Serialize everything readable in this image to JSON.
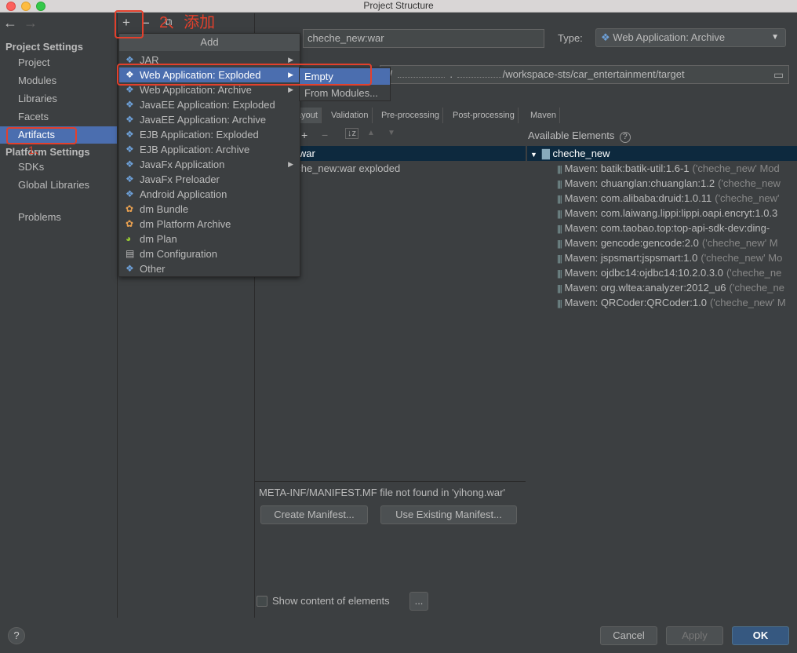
{
  "window": {
    "title": "Project Structure"
  },
  "nav": {
    "back_icon": "←",
    "forward_icon": "→",
    "project_settings_header": "Project Settings",
    "project_items": [
      "Project",
      "Modules",
      "Libraries",
      "Facets",
      "Artifacts"
    ],
    "platform_settings_header": "Platform Settings",
    "platform_items": [
      "SDKs",
      "Global Libraries"
    ],
    "problems": "Problems"
  },
  "toolbar": {
    "add": "+",
    "remove": "−"
  },
  "annotations": {
    "step2": "2、添加",
    "step1": "1、"
  },
  "artifact": {
    "name_value": "cheche_new:war",
    "type_label": "Type:",
    "type_value": "Web Application: Archive",
    "output_dir_prefix": "s/",
    "output_dir_middle": ".",
    "output_dir_value": "/workspace-sts/car_entertainment/target"
  },
  "tabs": [
    "ayout",
    "Validation",
    "Pre-processing",
    "Post-processing",
    "Maven"
  ],
  "output_tree": {
    "root": "g.war",
    "child": "eche_new:war exploded"
  },
  "available": {
    "label": "Available Elements",
    "help_icon": "?",
    "root": "cheche_new",
    "items": [
      {
        "text": "Maven: batik:batik-util:1.6-1",
        "suffix": "('cheche_new' Mod"
      },
      {
        "text": "Maven: chuanglan:chuanglan:1.2",
        "suffix": "('cheche_new"
      },
      {
        "text": "Maven: com.alibaba:druid:1.0.11",
        "suffix": "('cheche_new'"
      },
      {
        "text": "Maven: com.laiwang.lippi:lippi.oapi.encryt:1.0.3",
        "suffix": ""
      },
      {
        "text": "Maven: com.taobao.top:top-api-sdk-dev:ding-",
        "suffix": ""
      },
      {
        "text": "Maven: gencode:gencode:2.0",
        "suffix": "('cheche_new' M"
      },
      {
        "text": "Maven: jspsmart:jspsmart:1.0",
        "suffix": "('cheche_new' Mo"
      },
      {
        "text": "Maven: ojdbc14:ojdbc14:10.2.0.3.0",
        "suffix": "('cheche_ne"
      },
      {
        "text": "Maven: org.wltea:analyzer:2012_u6",
        "suffix": "('cheche_ne"
      },
      {
        "text": "Maven: QRCoder:QRCoder:1.0",
        "suffix": "('cheche_new' M"
      }
    ]
  },
  "manifest": {
    "message": "META-INF/MANIFEST.MF file not found in 'yihong.war'",
    "create_button": "Create Manifest...",
    "use_existing_button": "Use Existing Manifest..."
  },
  "show_content": {
    "label": "Show content of elements",
    "more": "..."
  },
  "footer": {
    "help": "?",
    "cancel": "Cancel",
    "apply": "Apply",
    "ok": "OK"
  },
  "add_popup": {
    "title": "Add",
    "items": [
      {
        "label": "JAR",
        "submenu": true
      },
      {
        "label": "Web Application: Exploded",
        "submenu": true
      },
      {
        "label": "Web Application: Archive",
        "submenu": true
      },
      {
        "label": "JavaEE Application: Exploded",
        "submenu": false
      },
      {
        "label": "JavaEE Application: Archive",
        "submenu": false
      },
      {
        "label": "EJB Application: Exploded",
        "submenu": false
      },
      {
        "label": "EJB Application: Archive",
        "submenu": false
      },
      {
        "label": "JavaFx Application",
        "submenu": true
      },
      {
        "label": "JavaFx Preloader",
        "submenu": false
      },
      {
        "label": "Android Application",
        "submenu": false
      },
      {
        "label": "dm Bundle",
        "submenu": false
      },
      {
        "label": "dm Platform Archive",
        "submenu": false
      },
      {
        "label": "dm Plan",
        "submenu": false
      },
      {
        "label": "dm Configuration",
        "submenu": false
      },
      {
        "label": "Other",
        "submenu": false
      }
    ],
    "submenu_items": [
      "Empty",
      "From Modules..."
    ]
  },
  "colors": {
    "selection": "#4b6eaf",
    "annotation": "#e3402c",
    "background": "#3c3f41"
  }
}
